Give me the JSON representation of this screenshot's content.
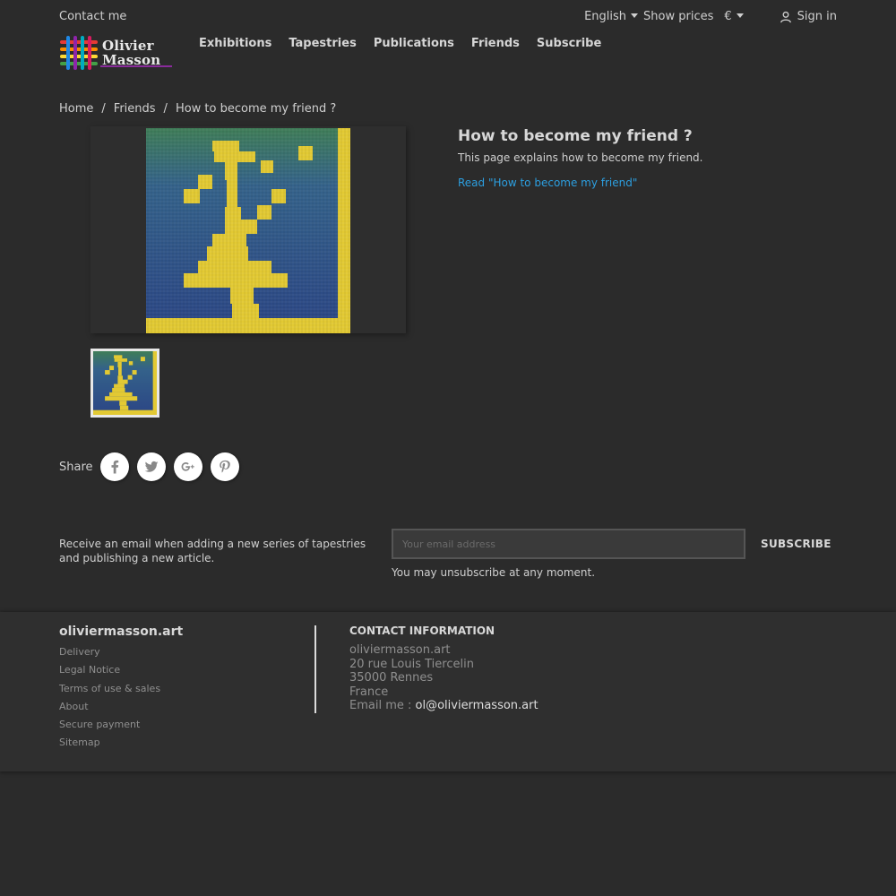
{
  "topbar": {
    "contact": "Contact me",
    "language": "English",
    "prices": "Show prices",
    "currency": "€",
    "signin": "Sign in"
  },
  "brand": {
    "name_line1": "Olivier",
    "name_line2": "Masson"
  },
  "nav": [
    "Exhibitions",
    "Tapestries",
    "Publications",
    "Friends",
    "Subscribe"
  ],
  "breadcrumb": [
    "Home",
    "Friends",
    "How to become my friend ?"
  ],
  "page": {
    "title": "How to become my friend ?",
    "description": "This page explains how to become my friend.",
    "read_link": "Read \"How to become my friend\""
  },
  "share": {
    "label": "Share",
    "networks": [
      "facebook-icon",
      "twitter-icon",
      "google-plus-icon",
      "pinterest-icon"
    ]
  },
  "newsletter": {
    "text": "Receive an email when adding a new series of tapestries and publishing a new article.",
    "placeholder": "Your email address",
    "submit": "SUBSCRIBE",
    "note": "You may unsubscribe at any moment."
  },
  "footer": {
    "brand": "oliviermasson.art",
    "links": [
      "Delivery",
      "Legal Notice",
      "Terms of use & sales",
      "About",
      "Secure payment",
      "Sitemap"
    ],
    "contact_title": "CONTACT INFORMATION",
    "contact_name": "oliviermasson.art",
    "address1": "20 rue Louis Tiercelin",
    "address2": "35000 Rennes",
    "country": "France",
    "email_label": "Email me :",
    "email": "ol@oliviermasson.art"
  },
  "colors": {
    "background": "#2b2b2b",
    "link": "#2c9fe0",
    "tapestry_blue": "#2f4f8f",
    "tapestry_yellow": "#e2c933",
    "logo_accent": "#8a2b9b"
  }
}
